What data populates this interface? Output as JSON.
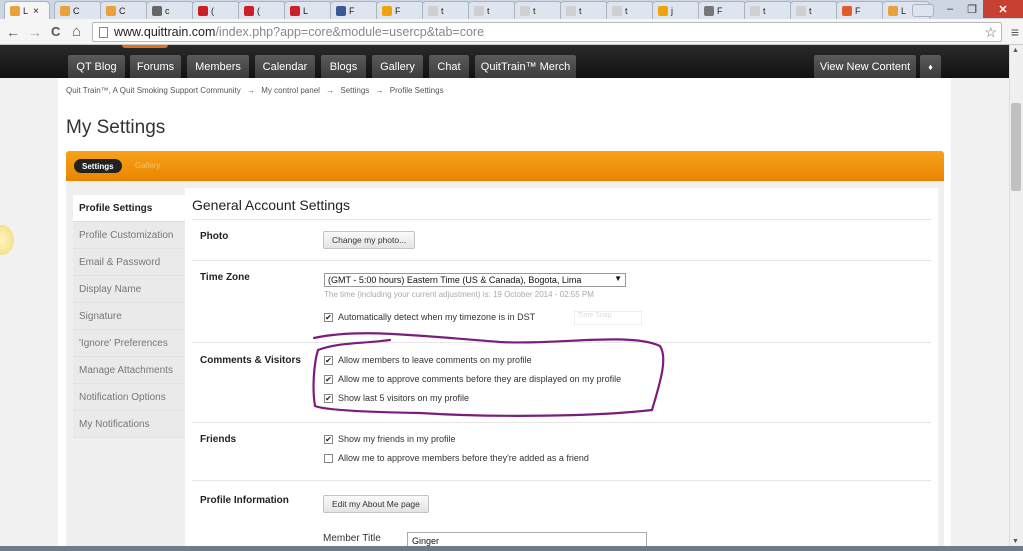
{
  "browser": {
    "tabs": [
      {
        "label": "L",
        "icon_color": "#e9a13b",
        "active": true
      },
      {
        "label": "C",
        "icon_color": "#e9a13b"
      },
      {
        "label": "C",
        "icon_color": "#e9a13b"
      },
      {
        "label": "c",
        "icon_color": "#666666"
      },
      {
        "label": "(",
        "icon_color": "#cb2027"
      },
      {
        "label": "(",
        "icon_color": "#cb2027"
      },
      {
        "label": "L",
        "icon_color": "#cb2027"
      },
      {
        "label": "F",
        "icon_color": "#3b5998"
      },
      {
        "label": "F",
        "icon_color": "#f0a30a"
      },
      {
        "label": "t",
        "icon_color": "#cfcfcf"
      },
      {
        "label": "t",
        "icon_color": "#cfcfcf"
      },
      {
        "label": "t",
        "icon_color": "#cfcfcf"
      },
      {
        "label": "t",
        "icon_color": "#cfcfcf"
      },
      {
        "label": "t",
        "icon_color": "#cfcfcf"
      },
      {
        "label": "j",
        "icon_color": "#f0a30a"
      },
      {
        "label": "F",
        "icon_color": "#777777"
      },
      {
        "label": "t",
        "icon_color": "#cfcfcf"
      },
      {
        "label": "t",
        "icon_color": "#cfcfcf"
      },
      {
        "label": "F",
        "icon_color": "#e05a2b"
      },
      {
        "label": "L",
        "icon_color": "#e9a13b"
      }
    ],
    "close_tab_glyph": "×",
    "window_controls": {
      "minimize": "–",
      "maximize": "❐",
      "close": "✕"
    },
    "url_host": "www.quittrain.com",
    "url_path": "/index.php?app=core&module=usercp&tab=core",
    "nav_icons": {
      "back": "←",
      "forward": "→",
      "reload": "C",
      "home": "⌂"
    },
    "star": "☆",
    "menu": "≡"
  },
  "site_nav": {
    "items": [
      "QT Blog",
      "Forums",
      "Members",
      "Calendar",
      "Blogs",
      "Gallery",
      "Chat",
      "QuitTrain™ Merch"
    ],
    "right_button": "View New Content",
    "pin_icon": "♦"
  },
  "breadcrumb": [
    "Quit Train™, A Quit Smoking Support Community",
    "→",
    "My control panel",
    "→",
    "Settings",
    "→",
    "Profile Settings"
  ],
  "page_title": "My Settings",
  "orange_tabs": {
    "active": "Settings",
    "other": "Gallery"
  },
  "sidebar": {
    "items": [
      "Profile Settings",
      "Profile Customization",
      "Email & Password",
      "Display Name",
      "Signature",
      "'Ignore' Preferences",
      "Manage Attachments",
      "Notification Options",
      "My Notifications"
    ]
  },
  "main": {
    "heading": "General Account Settings",
    "photo": {
      "label": "Photo",
      "button": "Change my photo..."
    },
    "timezone": {
      "label": "Time Zone",
      "selected": "(GMT - 5:00 hours) Eastern Time (US & Canada), Bogota, Lima",
      "hint": "The time (including your current adjustment) is: 19 October 2014 - 02:55 PM",
      "dst_checkbox": "Automatically detect when my timezone is in DST",
      "ghost_text": "Time Snap"
    },
    "comments": {
      "label": "Comments & Visitors",
      "options": [
        "Allow members to leave comments on my profile",
        "Allow me to approve comments before they are displayed on my profile",
        "Show last 5 visitors on my profile"
      ]
    },
    "friends": {
      "label": "Friends",
      "options": [
        {
          "text": "Show my friends in my profile",
          "checked": true
        },
        {
          "text": "Allow me to approve members before they're added as a friend",
          "checked": false
        }
      ]
    },
    "profile_info": {
      "label": "Profile Information",
      "button": "Edit my About Me page"
    },
    "member_title": {
      "label": "Member Title",
      "value": "Ginger"
    }
  },
  "colors": {
    "orange": "#f7a11a",
    "annotation": "#7b1d7e",
    "nav_dark": "#1a1a1a"
  },
  "check_glyph": "✔"
}
